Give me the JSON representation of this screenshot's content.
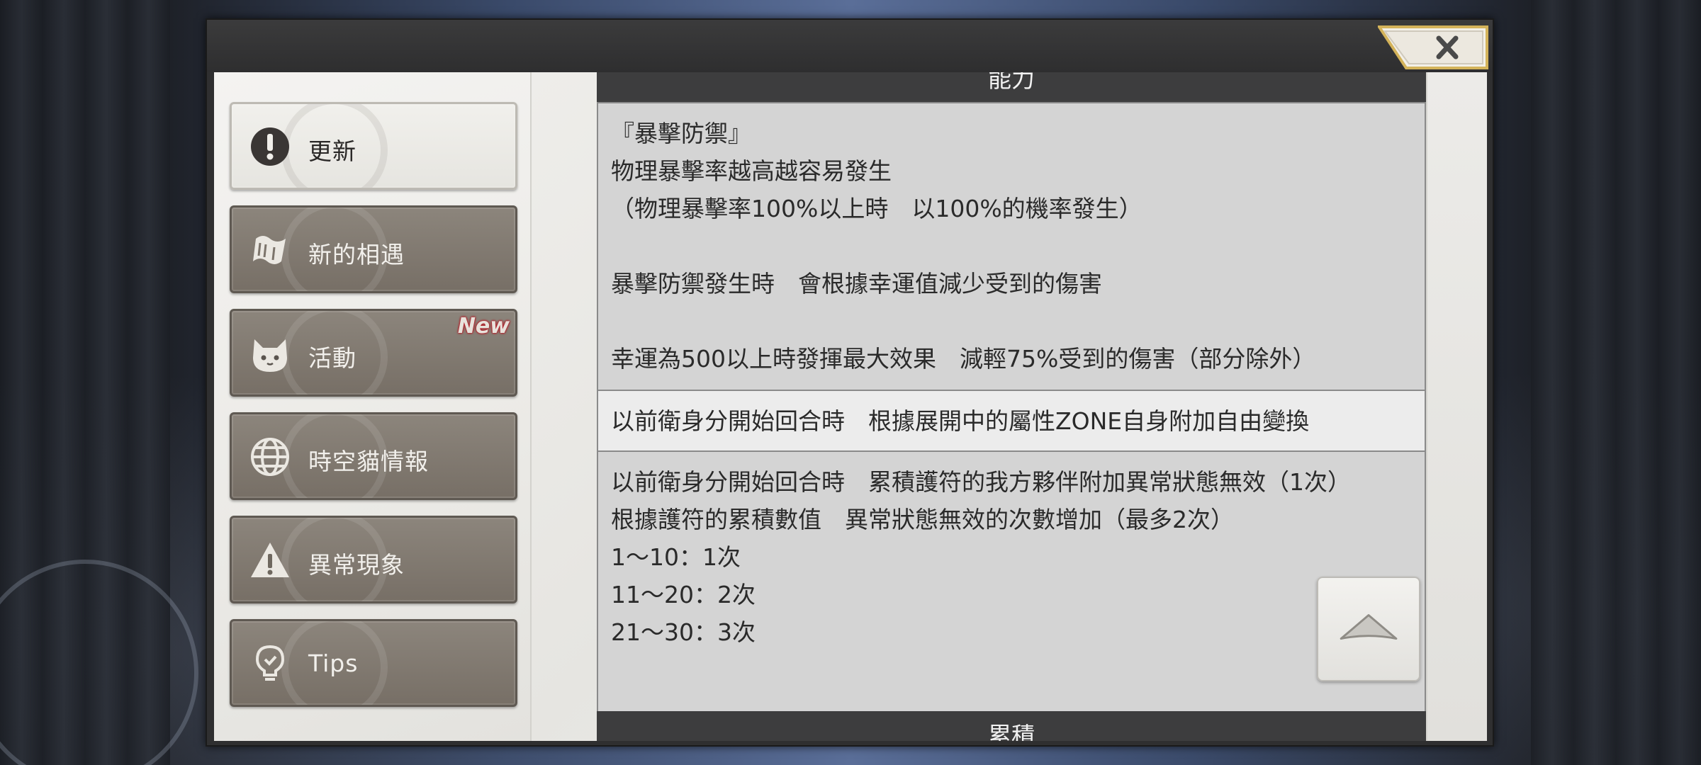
{
  "sidebar": {
    "items": [
      {
        "label": "更新",
        "icon": "exclamation-icon",
        "active": true,
        "badge": ""
      },
      {
        "label": "新的相遇",
        "icon": "scroll-icon",
        "active": false,
        "badge": ""
      },
      {
        "label": "活動",
        "icon": "cat-icon",
        "active": false,
        "badge": "New"
      },
      {
        "label": "時空貓情報",
        "icon": "globe-icon",
        "active": false,
        "badge": ""
      },
      {
        "label": "異常現象",
        "icon": "warning-icon",
        "active": false,
        "badge": ""
      },
      {
        "label": "Tips",
        "icon": "lightbulb-icon",
        "active": false,
        "badge": ""
      }
    ]
  },
  "content": {
    "top_header": "能力",
    "cell1": "『暴擊防禦』\n物理暴擊率越高越容易發生\n（物理暴擊率100%以上時　以100%的機率發生）\n\n暴擊防禦發生時　會根據幸運值減少受到的傷害\n\n幸運為500以上時發揮最大效果　減輕75%受到的傷害（部分除外）",
    "cell2": "以前衛身分開始回合時　根據展開中的屬性ZONE自身附加自由變換",
    "cell3": "以前衛身分開始回合時　累積護符的我方夥伴附加異常狀態無效（1次）\n根據護符的累積數值　異常狀態無效的次數增加（最多2次）\n1～10：1次\n11～20：2次\n21～30：3次",
    "bottom_header": "累積"
  },
  "controls": {
    "close_icon": "close-icon",
    "scroll_top_icon": "chevron-up-icon"
  },
  "colors": {
    "menu_button": "#7f776e",
    "menu_button_active": "#eeede9",
    "section_bar": "#3d3d3e",
    "cell_gray": "#d4d4d4",
    "cell_light": "#ececec",
    "new_badge": "#b3202a"
  }
}
